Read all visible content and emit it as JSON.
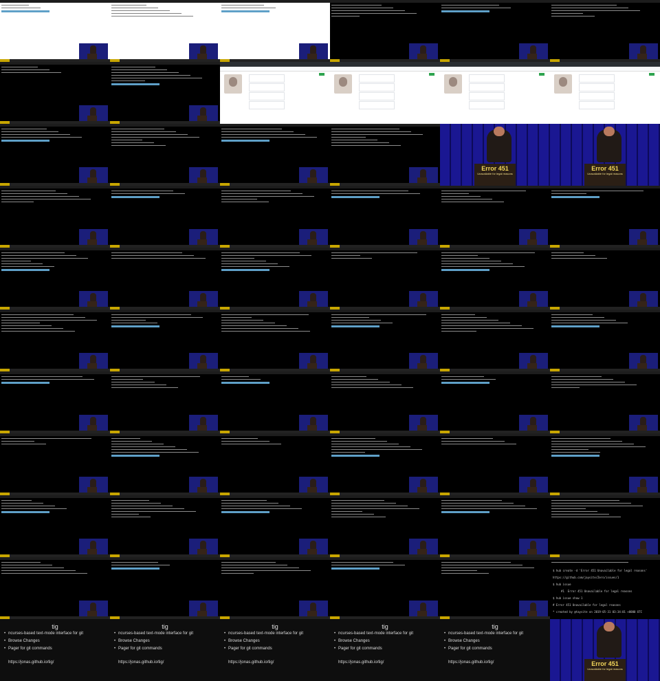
{
  "slide": {
    "title": "tig",
    "bullets": [
      "ncurses-based text-mode interface for git",
      "Browse Changes",
      "Pager for git commands"
    ],
    "url": "https://jonas.github.io/tig/"
  },
  "error": {
    "code": "Error 451",
    "caption": "Unavailable for legal reasons"
  },
  "terminal": {
    "lines": [
      "$ hub create -d 'Error 451 Unavailable for legal reasons'",
      "https://github.com/jaysite/Zero/issues/1",
      "$ hub issue",
      "     #1  Error 451 Unavailable for legal reasons",
      "$ hub issue show 1",
      "# Error 451 Unavailable for legal reasons",
      "* created by @taysite on 2019-05-31 03:34:01 +0000 UTC"
    ]
  },
  "colors": {
    "accent": "#c8a600",
    "stage": "#1b1e7a",
    "prompt": "#5fa0c8"
  }
}
